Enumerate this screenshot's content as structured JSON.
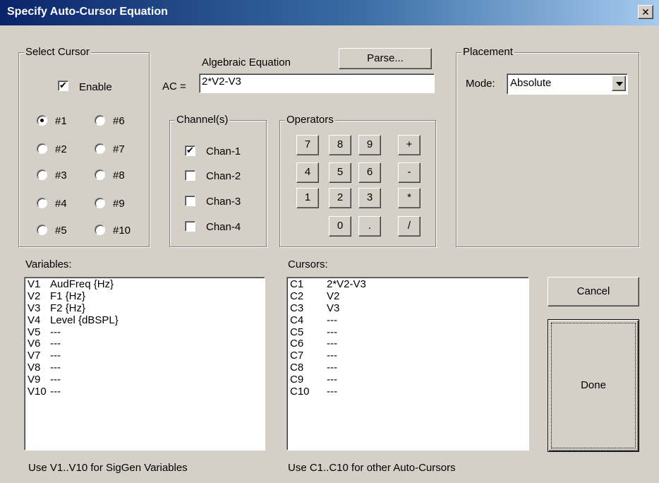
{
  "window": {
    "title": "Specify Auto-Cursor Equation",
    "close_glyph": "✕"
  },
  "select_cursor": {
    "legend": "Select Cursor",
    "enable_label": "Enable",
    "enable_checked": true,
    "selected": "#1",
    "radios": [
      "#1",
      "#2",
      "#3",
      "#4",
      "#5",
      "#6",
      "#7",
      "#8",
      "#9",
      "#10"
    ]
  },
  "equation": {
    "heading": "Algebraic Equation",
    "parse_label": "Parse...",
    "ac_label": "AC =",
    "value": "2*V2-V3"
  },
  "channels": {
    "legend": "Channel(s)",
    "items": [
      {
        "label": "Chan-1",
        "checked": true
      },
      {
        "label": "Chan-2",
        "checked": false
      },
      {
        "label": "Chan-3",
        "checked": false
      },
      {
        "label": "Chan-4",
        "checked": false
      }
    ]
  },
  "operators": {
    "legend": "Operators",
    "keys": [
      "7",
      "8",
      "9",
      "+",
      "4",
      "5",
      "6",
      "-",
      "1",
      "2",
      "3",
      "*",
      "0",
      ".",
      "/"
    ]
  },
  "placement": {
    "legend": "Placement",
    "mode_label": "Mode:",
    "mode_value": "Absolute"
  },
  "variables": {
    "label": "Variables:",
    "items": [
      {
        "key": "V1",
        "value": "AudFreq {Hz}"
      },
      {
        "key": "V2",
        "value": "F1 {Hz}"
      },
      {
        "key": "V3",
        "value": "F2 {Hz}"
      },
      {
        "key": "V4",
        "value": "Level {dBSPL}"
      },
      {
        "key": "V5",
        "value": "---"
      },
      {
        "key": "V6",
        "value": "---"
      },
      {
        "key": "V7",
        "value": "---"
      },
      {
        "key": "V8",
        "value": "---"
      },
      {
        "key": "V9",
        "value": "---"
      },
      {
        "key": "V10",
        "value": "---"
      }
    ],
    "hint": "Use V1..V10  for SigGen Variables"
  },
  "cursors": {
    "label": "Cursors:",
    "items": [
      {
        "key": "C1",
        "value": "2*V2-V3"
      },
      {
        "key": "C2",
        "value": "V2"
      },
      {
        "key": "C3",
        "value": "V3"
      },
      {
        "key": "C4",
        "value": "---"
      },
      {
        "key": "C5",
        "value": "---"
      },
      {
        "key": "C6",
        "value": "---"
      },
      {
        "key": "C7",
        "value": "---"
      },
      {
        "key": "C8",
        "value": "---"
      },
      {
        "key": "C9",
        "value": "---"
      },
      {
        "key": "C10",
        "value": "---"
      }
    ],
    "hint": "Use  C1..C10  for other Auto-Cursors"
  },
  "buttons": {
    "cancel": "Cancel",
    "done": "Done"
  }
}
